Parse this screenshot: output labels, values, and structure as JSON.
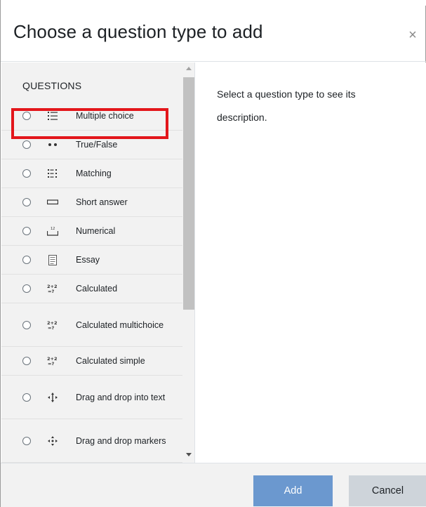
{
  "dialog": {
    "title": "Choose a question type to add",
    "close_glyph": "×"
  },
  "questions": {
    "heading": "QUESTIONS",
    "items": [
      {
        "label": "Multiple choice",
        "icon": "multiple-choice-icon"
      },
      {
        "label": "True/False",
        "icon": "true-false-icon"
      },
      {
        "label": "Matching",
        "icon": "matching-icon"
      },
      {
        "label": "Short answer",
        "icon": "short-answer-icon"
      },
      {
        "label": "Numerical",
        "icon": "numerical-icon"
      },
      {
        "label": "Essay",
        "icon": "essay-icon"
      },
      {
        "label": "Calculated",
        "icon": "calculated-icon"
      },
      {
        "label": "Calculated multichoice",
        "icon": "calculated-multichoice-icon"
      },
      {
        "label": "Calculated simple",
        "icon": "calculated-simple-icon"
      },
      {
        "label": "Drag and drop into text",
        "icon": "drag-drop-text-icon"
      },
      {
        "label": "Drag and drop markers",
        "icon": "drag-drop-markers-icon"
      }
    ]
  },
  "description": {
    "text": "Select a question type to see its description."
  },
  "footer": {
    "add_label": "Add",
    "cancel_label": "Cancel"
  },
  "colors": {
    "highlight": "#e3161b",
    "primary_button": "#6b98cf",
    "secondary_button": "#ced4da"
  }
}
